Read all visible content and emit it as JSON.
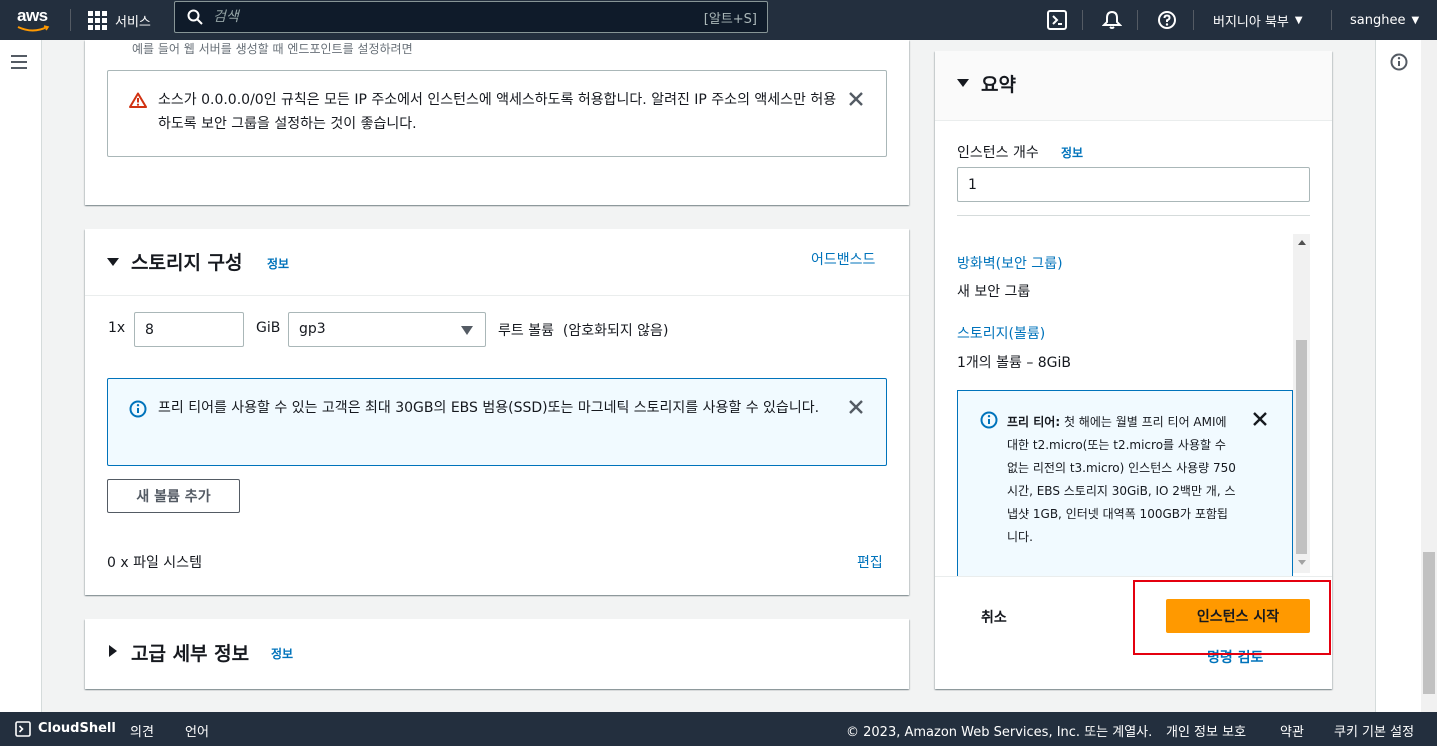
{
  "nav": {
    "logo": "aws",
    "services": "서비스",
    "search_placeholder": "검색",
    "search_shortcut": "[알트+S]",
    "region": "버지니아 북부",
    "user": "sanghee"
  },
  "network": {
    "hint": "예를 들어 웹 서버를 생성할 때 엔드포인트를 설정하려면",
    "warning": "소스가 0.0.0.0/0인 규칙은 모든 IP 주소에서 인스턴스에 액세스하도록 허용합니다. 알려진 IP 주소의 액세스만 허용하도록 보안 그룹을 설정하는 것이 좋습니다."
  },
  "storage": {
    "title": "스토리지 구성",
    "info": "정보",
    "advanced": "어드밴스드",
    "multiplier": "1x",
    "size": "8",
    "unit": "GiB",
    "volume_type": "gp3",
    "volume_desc": "루트 볼륨  (암호화되지 않음)",
    "info_alert": "프리 티어를 사용할 수 있는 고객은 최대 30GB의 EBS 범용(SSD)또는 마그네틱 스토리지를 사용할 수 있습니다.",
    "add_volume": "새 볼륨 추가",
    "filesystems": "0 x 파일 시스템",
    "edit": "편집"
  },
  "advanced_details": {
    "title": "고급 세부 정보",
    "info": "정보"
  },
  "summary": {
    "title": "요약",
    "instance_count_label": "인스턴스 개수",
    "info": "정보",
    "instance_count": "1",
    "firewall_link": "방화벽(보안 그룹)",
    "firewall_value": "새 보안 그룹",
    "storage_link": "스토리지(볼륨)",
    "storage_value": "1개의 볼륨 – 8GiB",
    "freetier_bold": "프리 티어:",
    "freetier_text": " 첫 해에는 월별 프리 티어 AMI에 대한 t2.micro(또는 t2.micro를 사용할 수 없는 리전의 t3.micro) 인스턴스 사용량 750시간, EBS 스토리지 30GiB, IO 2백만 개, 스냅샷 1GB, 인터넷 대역폭 100GB가 포함됩니다.",
    "cancel": "취소",
    "launch": "인스턴스 시작",
    "review": "명령 검토"
  },
  "footer": {
    "cloudshell": "CloudShell",
    "feedback": "의견",
    "language": "언어",
    "copyright": "© 2023, Amazon Web Services, Inc. 또는 계열사.",
    "privacy": "개인 정보 보호",
    "terms": "약관",
    "cookies": "쿠키 기본 설정"
  },
  "colors": {
    "nav_bg": "#232f3e",
    "primary_button": "#ff9900",
    "link": "#0073bb",
    "warning": "#d13212",
    "highlight": "#e4000f"
  }
}
